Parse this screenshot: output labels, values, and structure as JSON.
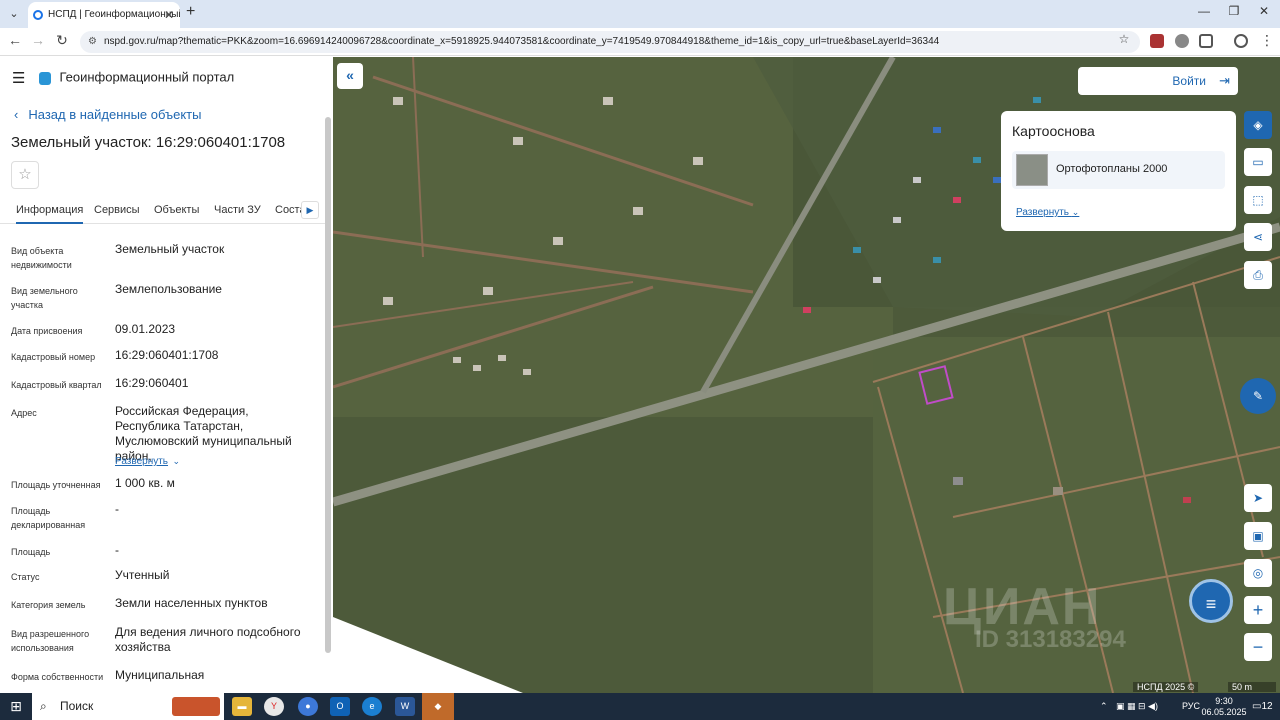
{
  "browser": {
    "tab_title": "НСПД | Геоинформационный",
    "url": "nspd.gov.ru/map?thematic=PKK&zoom=16.696914240096728&coordinate_x=5918925.944073581&coordinate_y=7419549.970844918&theme_id=1&is_copy_url=true&baseLayerId=36344"
  },
  "portal": {
    "title": "Геоинформационный портал",
    "back_label": "Назад в найденные объекты",
    "object_title": "Земельный участок: 16:29:060401:1708",
    "tabs": [
      "Информация",
      "Сервисы",
      "Объекты",
      "Части ЗУ",
      "Соста"
    ]
  },
  "properties": [
    {
      "key": "Вид объекта недвижимости",
      "value": "Земельный участок"
    },
    {
      "key": "Вид земельного участка",
      "value": "Землепользование"
    },
    {
      "key": "Дата присвоения",
      "value": "09.01.2023"
    },
    {
      "key": "Кадастровый номер",
      "value": "16:29:060401:1708"
    },
    {
      "key": "Кадастровый квартал",
      "value": "16:29:060401"
    },
    {
      "key": "Адрес",
      "value": "Российская Федерация, Республика Татарстан, Муслюмовский муниципальный район,",
      "expand": "Развернуть"
    },
    {
      "key": "Площадь уточненная",
      "value": "1 000 кв. м"
    },
    {
      "key": "Площадь декларированная",
      "value": "-"
    },
    {
      "key": "Площадь",
      "value": "-"
    },
    {
      "key": "Статус",
      "value": "Учтенный"
    },
    {
      "key": "Категория земель",
      "value": "Земли населенных пунктов"
    },
    {
      "key": "Вид разрешенного использования",
      "value": "Для ведения личного подсобного хозяйства"
    },
    {
      "key": "Форма собственности",
      "value": "Муниципальная"
    }
  ],
  "map": {
    "login_label": "Войти",
    "basemap_title": "Картооснова",
    "basemap_item": "Ортофотопланы 2000",
    "basemap_expand": "Развернуть",
    "attribution": "НСПД 2025 ©",
    "scale": "50 m",
    "watermark": "ЦИАН",
    "watermark_id": "ID 313183294"
  },
  "taskbar": {
    "search_label": "Поиск",
    "lang": "РУС",
    "time": "9:30",
    "date": "06.05.2025",
    "notifications": "12"
  }
}
